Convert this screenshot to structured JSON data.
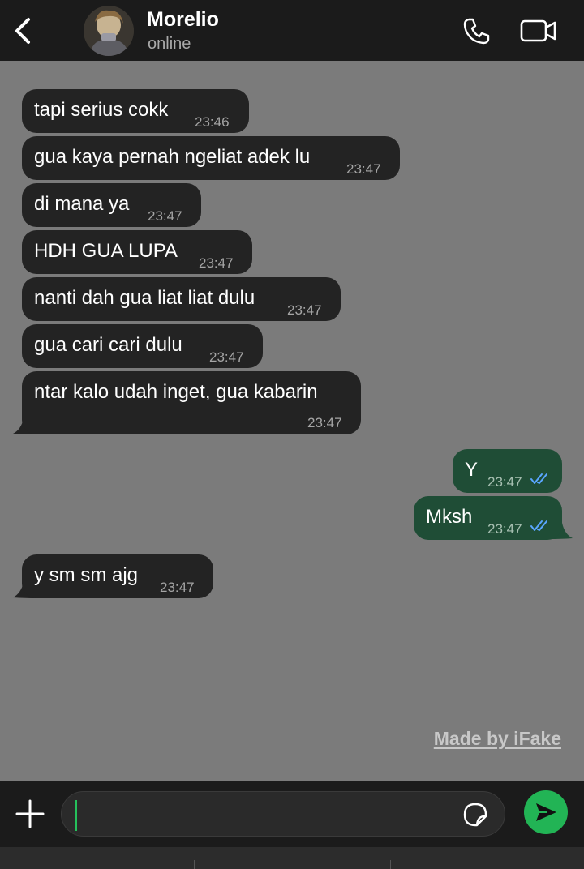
{
  "header": {
    "contact_name": "Morelio",
    "status": "online",
    "icons": {
      "back": "chevron-left-icon",
      "call": "phone-icon",
      "video": "video-camera-icon"
    }
  },
  "messages": [
    {
      "direction": "incoming",
      "text": "tapi serius cokk",
      "time": "23:46"
    },
    {
      "direction": "incoming",
      "text": "gua kaya pernah ngeliat adek lu",
      "time": "23:47"
    },
    {
      "direction": "incoming",
      "text": "di mana ya",
      "time": "23:47"
    },
    {
      "direction": "incoming",
      "text": "HDH GUA LUPA",
      "time": "23:47"
    },
    {
      "direction": "incoming",
      "text": "nanti dah gua liat liat dulu",
      "time": "23:47"
    },
    {
      "direction": "incoming",
      "text": "gua cari cari dulu",
      "time": "23:47"
    },
    {
      "direction": "incoming",
      "text": "ntar kalo udah inget, gua kabarin",
      "time": "23:47"
    },
    {
      "direction": "outgoing",
      "text": "Y",
      "time": "23:47",
      "status": "read"
    },
    {
      "direction": "outgoing",
      "text": "Mksh",
      "time": "23:47",
      "status": "read"
    },
    {
      "direction": "incoming",
      "text": "y sm sm ajg",
      "time": "23:47"
    }
  ],
  "watermark": "Made by iFake",
  "composer": {
    "value": "",
    "icons": {
      "attach": "plus-icon",
      "sticker": "sticker-icon",
      "send": "send-arrow-icon"
    }
  },
  "colors": {
    "chat_background": "#7b7b7b",
    "header_background": "#1b1b1b",
    "incoming_bubble": "#232323",
    "outgoing_bubble": "#1f4d36",
    "send_button": "#22b455",
    "read_ticks": "#5aa6ff"
  }
}
